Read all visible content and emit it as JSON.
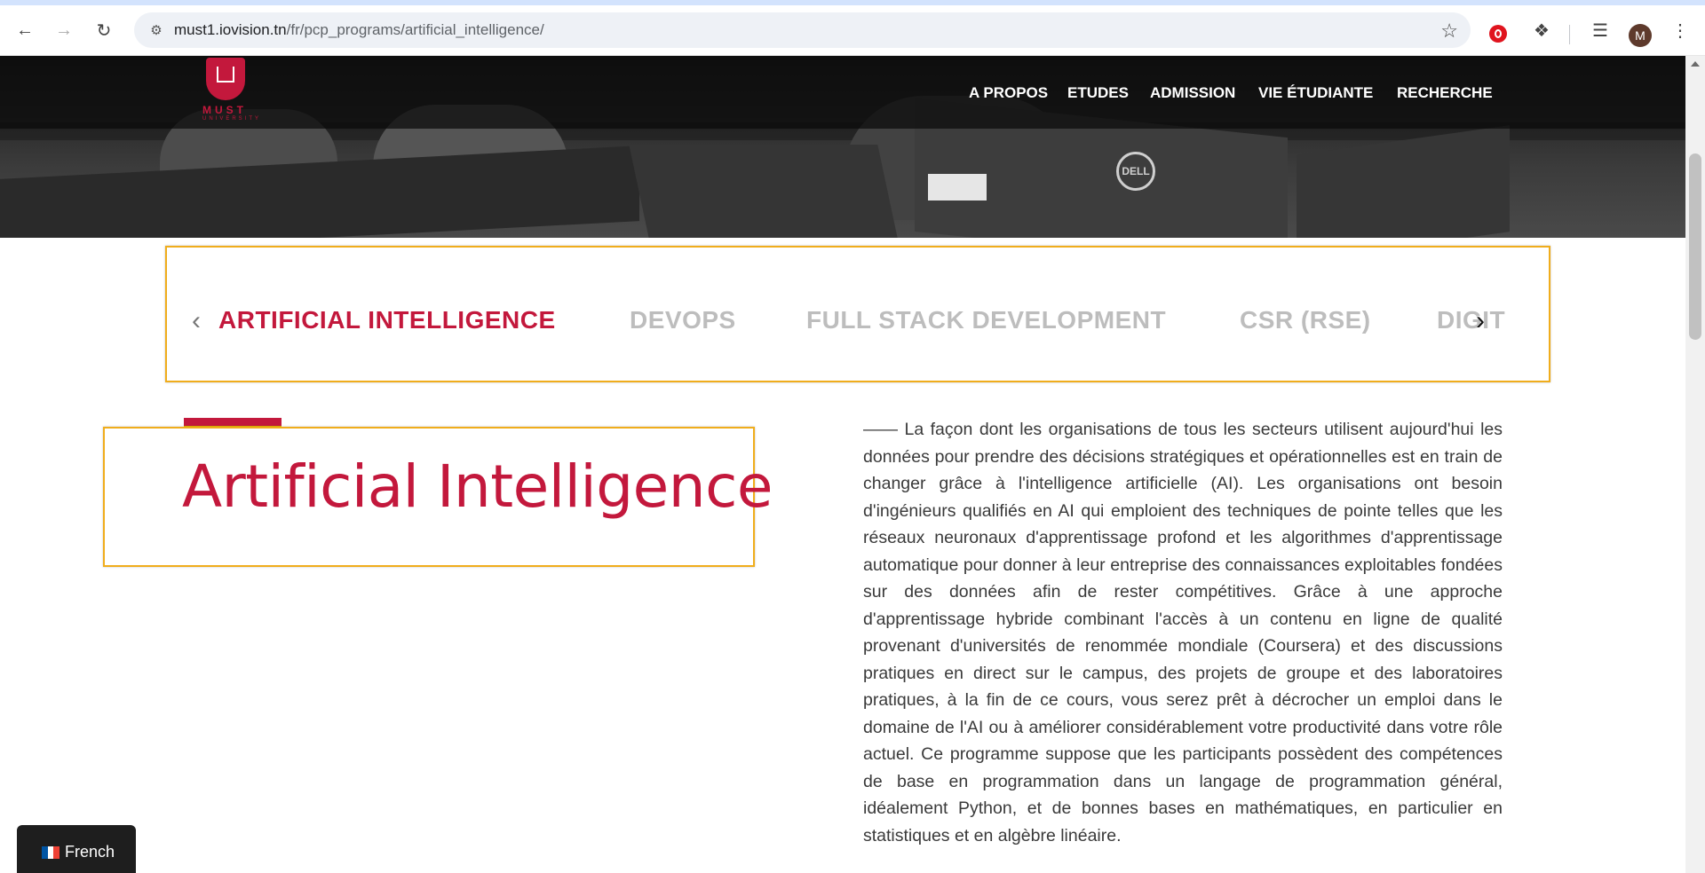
{
  "browser": {
    "url_host": "must1.iovision.tn",
    "url_path": "/fr/pcp_programs/artificial_intelligence/",
    "avatar_initial": "M"
  },
  "nav": {
    "logo_text": "MUST",
    "logo_sub": "UNIVERSITY",
    "items": [
      "A PROPOS",
      "ETUDES",
      "ADMISSION",
      "VIE ÉTUDIANTE",
      "RECHERCHE"
    ]
  },
  "hero": {
    "monitor_brand": "DELL"
  },
  "carousel": {
    "items": [
      "ARTIFICIAL INTELLIGENCE",
      "DEVOPS",
      "FULL STACK DEVELOPMENT",
      "CSR (RSE)",
      "DIGIT"
    ],
    "active_index": 0
  },
  "program": {
    "title": "Artificial Intelligence",
    "description": "—— La façon dont les organisations de tous les secteurs utilisent aujourd'hui les données pour prendre des décisions stratégiques et opérationnelles est en train de changer grâce à l'intelligence artificielle (AI). Les organisations ont besoin d'ingénieurs qualifiés en AI qui emploient des techniques de pointe telles que les réseaux neuronaux d'apprentissage profond et les algorithmes d'apprentissage automatique pour donner à leur entreprise des connaissances exploitables fondées sur des données afin de rester compétitives. Grâce à une approche d'apprentissage hybride combinant l'accès à un contenu en ligne de qualité provenant d'universités de renommée mondiale (Coursera) et des discussions pratiques en direct sur le campus, des projets de groupe et des laboratoires pratiques, à la fin de ce cours, vous serez prêt à décrocher un emploi dans le domaine de l'AI ou à améliorer considérablement votre productivité dans votre rôle actuel. Ce programme suppose que les participants possèdent des compétences de base en programmation dans un langage de programmation général, idéalement Python, et de bonnes bases en mathématiques, en particulier en statistiques et en algèbre linéaire."
  },
  "language": {
    "label": "French"
  },
  "colors": {
    "brand_red": "#c3183c",
    "highlight_border": "#f0ad1c",
    "inactive_tab": "#bdbdbd"
  }
}
